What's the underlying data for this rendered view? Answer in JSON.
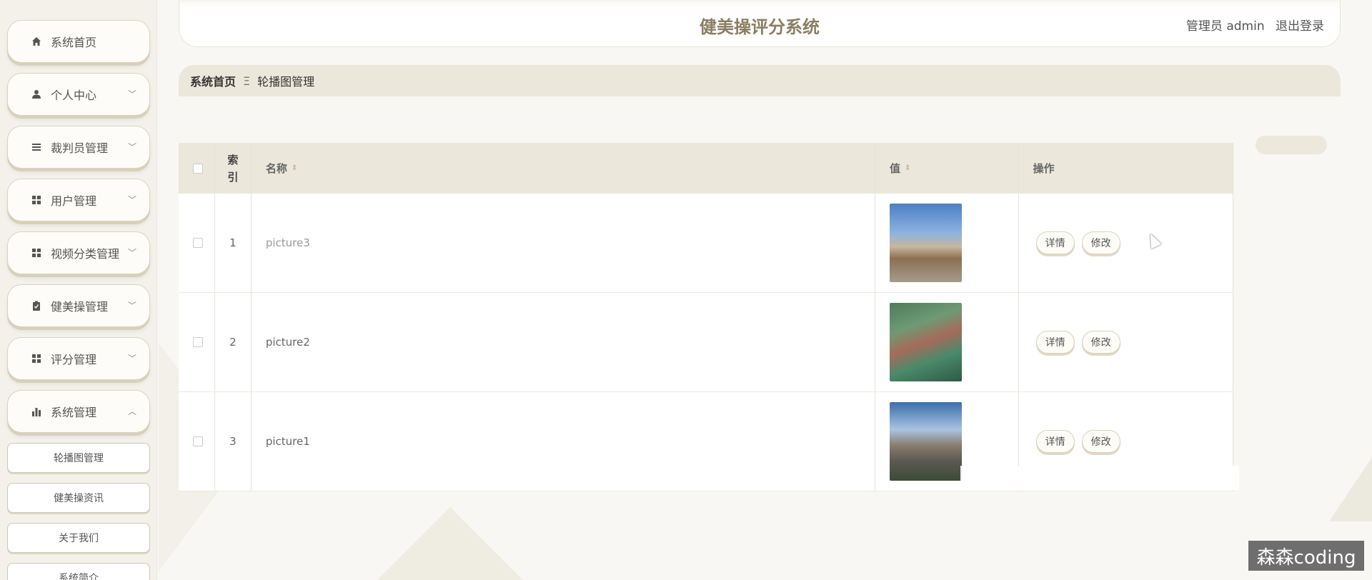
{
  "header": {
    "title": "健美操评分系统",
    "user_role": "管理员 admin",
    "logout": "退出登录"
  },
  "sidebar": {
    "items": [
      {
        "label": "系统首页",
        "icon": "home-icon",
        "has_chevron": false
      },
      {
        "label": "个人中心",
        "icon": "user-icon",
        "has_chevron": true
      },
      {
        "label": "裁判员管理",
        "icon": "list-icon",
        "has_chevron": true
      },
      {
        "label": "用户管理",
        "icon": "grid-icon",
        "has_chevron": true
      },
      {
        "label": "视频分类管理",
        "icon": "grid-icon",
        "has_chevron": true
      },
      {
        "label": "健美操管理",
        "icon": "clipboard-icon",
        "has_chevron": true
      },
      {
        "label": "评分管理",
        "icon": "grid-icon",
        "has_chevron": true
      },
      {
        "label": "系统管理",
        "icon": "bar-chart-icon",
        "has_chevron": true,
        "expanded": true
      }
    ],
    "subitems": [
      {
        "label": "轮播图管理"
      },
      {
        "label": "健美操资讯"
      },
      {
        "label": "关于我们"
      },
      {
        "label": "系统简介"
      }
    ]
  },
  "breadcrumb": {
    "home": "系统首页",
    "separator": "Ξ",
    "current": "轮播图管理"
  },
  "table": {
    "headers": {
      "index": "索引",
      "name": "名称",
      "value": "值",
      "ops": "操作"
    },
    "rows": [
      {
        "index": "1",
        "name": "picture3",
        "image": "campus-building-photo"
      },
      {
        "index": "2",
        "name": "picture2",
        "image": "aerial-campus-photo"
      },
      {
        "index": "3",
        "name": "picture1",
        "image": "tall-building-photo"
      }
    ],
    "detail_label": "详情",
    "edit_label": "修改"
  },
  "watermark": "森森coding",
  "colors": {
    "accent": "#8b7d60",
    "header_bg": "#ebe7da",
    "sidebar_bg": "#f3f1ea"
  }
}
